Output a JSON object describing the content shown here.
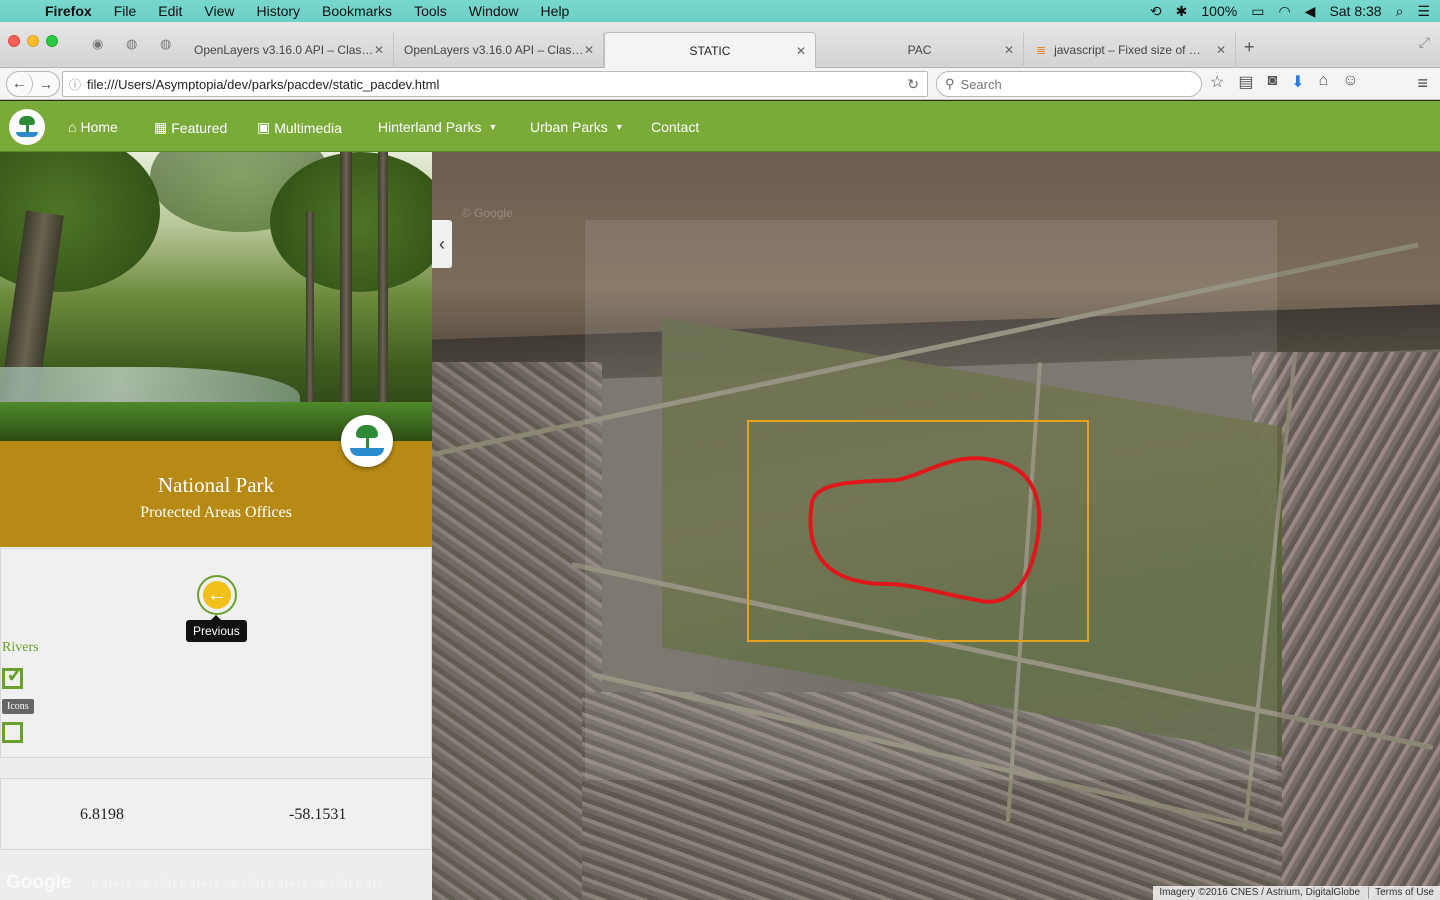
{
  "menubar": {
    "items": [
      "Firefox",
      "File",
      "Edit",
      "View",
      "History",
      "Bookmarks",
      "Tools",
      "Window",
      "Help"
    ],
    "battery": "100%",
    "clock": "Sat 8:38"
  },
  "browser": {
    "tabs": [
      {
        "label": "OpenLayers v3.16.0 API – Clas…"
      },
      {
        "label": "OpenLayers v3.16.0 API – Clas…"
      },
      {
        "label": "STATIC"
      },
      {
        "label": "PAC"
      },
      {
        "label": "javascript – Fixed size of …"
      }
    ],
    "url": "file:///Users/Asymptopia/dev/parks/pacdev/static_pacdev.html",
    "search_placeholder": "Search"
  },
  "site": {
    "nav": {
      "home": "Home",
      "featured": "Featured",
      "multimedia": "Multimedia",
      "hinterland": "Hinterland Parks",
      "urban": "Urban Parks",
      "contact": "Contact"
    },
    "park": {
      "title": "National Park",
      "subtitle": "Protected Areas Offices"
    },
    "controls": {
      "previous_tooltip": "Previous",
      "rivers_label": "Rivers",
      "rivers_checked": true,
      "icons_label": "Icons",
      "icons_checked": false
    },
    "coords": {
      "lat": "6.8198",
      "lon": "-58.1531"
    },
    "footer": {
      "google": "Google",
      "mouse_position": "6.81641,-58.1531 6.81641,-58.1531 6.81641,-58.1531 6.816"
    },
    "map": {
      "attribution": "Imagery ©2016 CNES / Astrium, DigitalGlobe",
      "terms": "Terms of Use"
    }
  }
}
